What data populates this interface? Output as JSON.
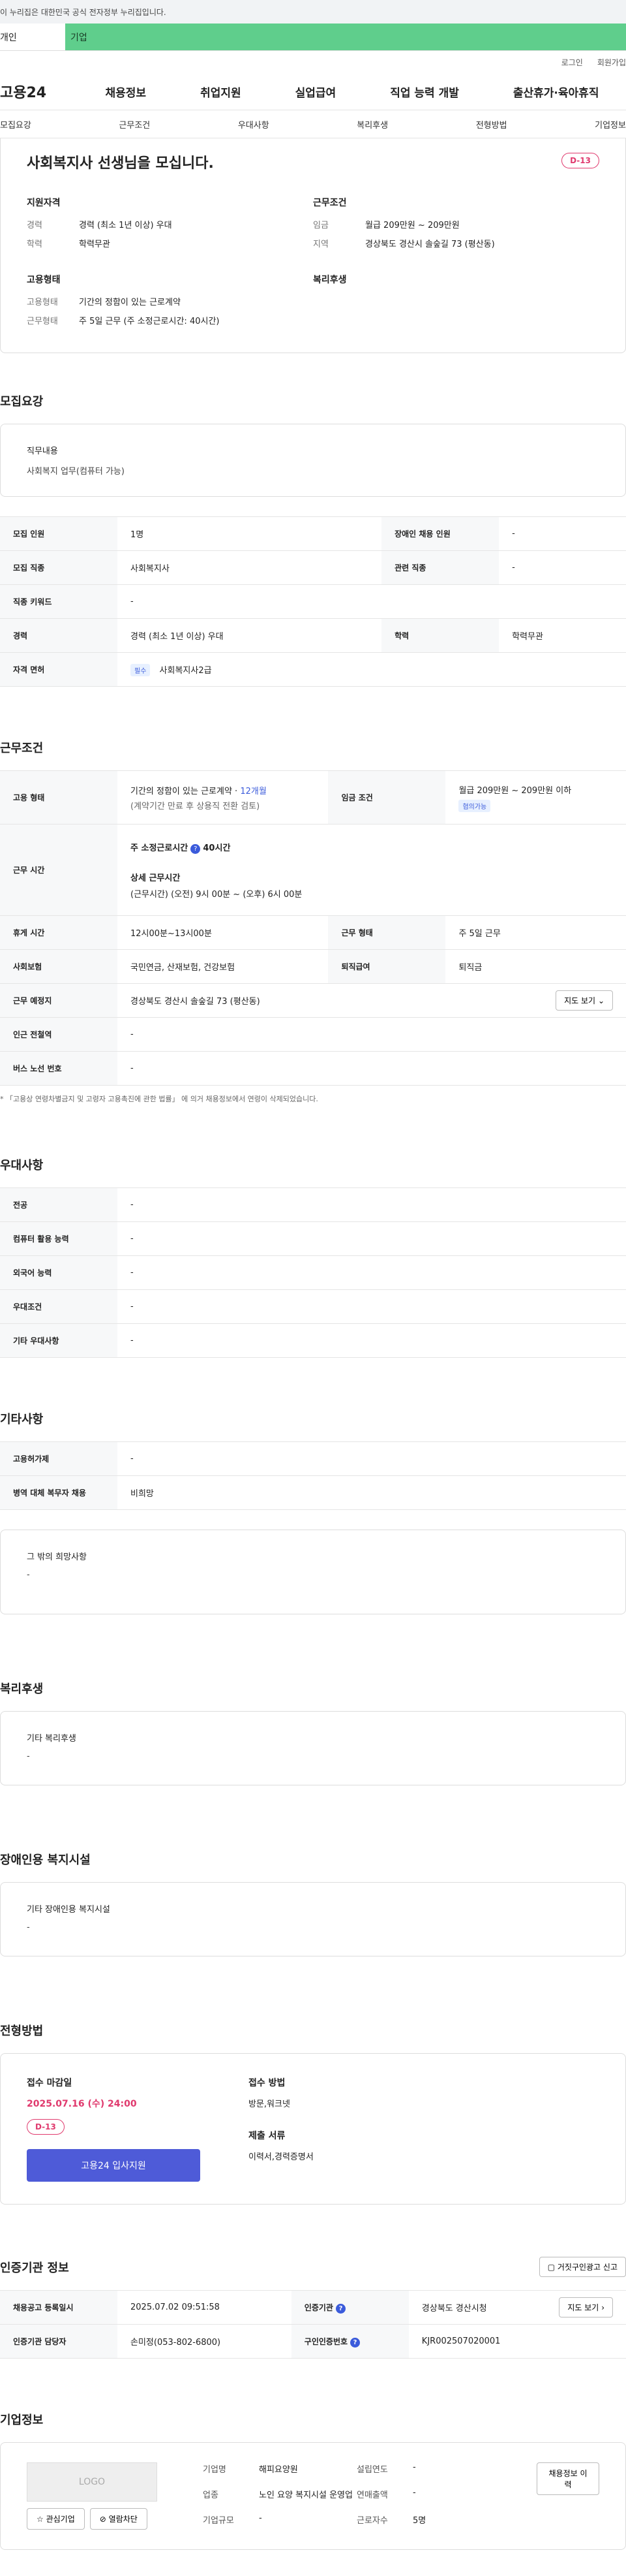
{
  "gov_notice": "이 누리집은 대한민국 공식 전자정부 누리집입니다.",
  "tabs": [
    "개인",
    "기업"
  ],
  "top_links": [
    "로그인",
    "회원가입"
  ],
  "logo": "고용24",
  "gnb": [
    "채용정보",
    "취업지원",
    "실업급여",
    "직업 능력 개발",
    "출산휴가·육아휴직"
  ],
  "lnb": [
    "모집요강",
    "근무조건",
    "우대사항",
    "복리후생",
    "전형방법",
    "기업정보"
  ],
  "summary": {
    "title": "사회복지사 선생님을 모십니다.",
    "dday": "D-13",
    "qual_title": "지원자격",
    "qual": [
      {
        "k": "경력",
        "v": "경력 (최소 1년 이상) 우대"
      },
      {
        "k": "학력",
        "v": "학력무관"
      }
    ],
    "cond_title": "근무조건",
    "cond": [
      {
        "k": "임금",
        "v": "월급 209만원 ~ 209만원"
      },
      {
        "k": "지역",
        "v": "경상북도 경산시 솔숲길 73 (평산동)"
      }
    ],
    "emp_title": "고용형태",
    "emp": [
      {
        "k": "고용형태",
        "v": "기간의 정함이 있는 근로계약"
      },
      {
        "k": "근무형태",
        "v": "주 5일 근무 (주 소정근로시간: 40시간)"
      }
    ],
    "welfare_title": "복리후생"
  },
  "recruit": {
    "title": "모집요강",
    "duty_label": "직무내용",
    "duty_value": "사회복지 업무(컴퓨터 가능)",
    "rows": {
      "count_label": "모집 인원",
      "count": "1명",
      "disabled_label": "장애인 채용 인원",
      "disabled": "-",
      "job_label": "모집 직종",
      "job": "사회복지사",
      "related_label": "관련 직종",
      "related": "-",
      "keyword_label": "직종 키워드",
      "keyword": "-",
      "career_label": "경력",
      "career": "경력 (최소 1년 이상) 우대",
      "edu_label": "학력",
      "edu": "학력무관",
      "license_label": "자격 면허",
      "license_badge": "필수",
      "license": "사회복지사2급"
    }
  },
  "conditions": {
    "title": "근무조건",
    "emp_label": "고용 형태",
    "emp_value": "기간의 정함이 있는 근로계약 · ",
    "emp_months": "12개월",
    "emp_sub": "(계약기간 만료 후 상용직 전환 검토)",
    "wage_label": "임금 조건",
    "wage_value": "월급 209만원 ~ 209만원 이하",
    "wage_badge": "협의가능",
    "time_label": "근무 시간",
    "time_weekly_label": "주 소정근로시간",
    "time_weekly": "40시간",
    "time_detail_label": "상세 근무시간",
    "time_detail": "(근무시간) (오전) 9시 00분 ~ (오후) 6시 00분",
    "break_label": "휴게 시간",
    "break": "12시00분~13시00분",
    "workform_label": "근무 형태",
    "workform": "주 5일 근무",
    "insurance_label": "사회보험",
    "insurance": "국민연금, 산재보험, 건강보험",
    "severance_label": "퇴직급여",
    "severance": "퇴직금",
    "place_label": "근무 예정지",
    "place": "경상북도 경산시 솔숲길 73 (평산동)",
    "map_btn": "지도 보기",
    "subway_label": "인근 전철역",
    "subway": "-",
    "bus_label": "버스 노선 번호",
    "bus": "-",
    "note": "* 「고용상 연령차별금지 및 고령자 고용촉진에 관한 법률」 에 의거 채용정보에서 연령이 삭제되었습니다."
  },
  "preference": {
    "title": "우대사항",
    "rows": [
      {
        "k": "전공",
        "v": "-"
      },
      {
        "k": "컴퓨터 활용 능력",
        "v": "-"
      },
      {
        "k": "외국어 능력",
        "v": "-"
      },
      {
        "k": "우대조건",
        "v": "-"
      },
      {
        "k": "기타 우대사항",
        "v": "-"
      }
    ]
  },
  "etc": {
    "title": "기타사항",
    "rows": [
      {
        "k": "고용허가제",
        "v": "-"
      },
      {
        "k": "병역 대체 복무자 채용",
        "v": "비희망"
      }
    ],
    "other_label": "그 밖의 희망사항",
    "other_value": "-"
  },
  "welfare": {
    "title": "복리후생",
    "label": "기타 복리후생",
    "value": "-"
  },
  "disabled_fac": {
    "title": "장애인용 복지시설",
    "label": "기타 장애인용 복지시설",
    "value": "-"
  },
  "process": {
    "title": "전형방법",
    "deadline_label": "접수 마감일",
    "deadline": "2025.07.16 (수) 24:00",
    "dday": "D-13",
    "apply_btn": "고용24 입사지원",
    "method_label": "접수 방법",
    "method": "방문,워크넷",
    "docs_label": "제출 서류",
    "docs": "이력서,경력증명서"
  },
  "agency": {
    "title": "인증기관 정보",
    "report_btn": "거짓구인광고 신고",
    "reg_label": "채용공고 등록일시",
    "reg": "2025.07.02 09:51:58",
    "org_label": "인증기관",
    "org": "경상북도 경산시청",
    "map_btn": "지도 보기",
    "mgr_label": "인증기관 담당자",
    "mgr": "손미정(053-802-6800)",
    "num_label": "구인인증번호",
    "num": "KJR002507020001"
  },
  "company": {
    "title": "기업정보",
    "logo_text": "LOGO",
    "fav_btn": "관심기업",
    "block_btn": "열람차단",
    "name_label": "기업명",
    "name": "해피요양원",
    "biz_label": "업종",
    "biz": "노인 요양 복지시설 운영업",
    "size_label": "기업규모",
    "size": "-",
    "founded_label": "설립연도",
    "founded": "-",
    "sales_label": "연매출액",
    "sales": "-",
    "emp_label": "근로자수",
    "emp": "5명",
    "history_btn": "채용정보 이력"
  }
}
